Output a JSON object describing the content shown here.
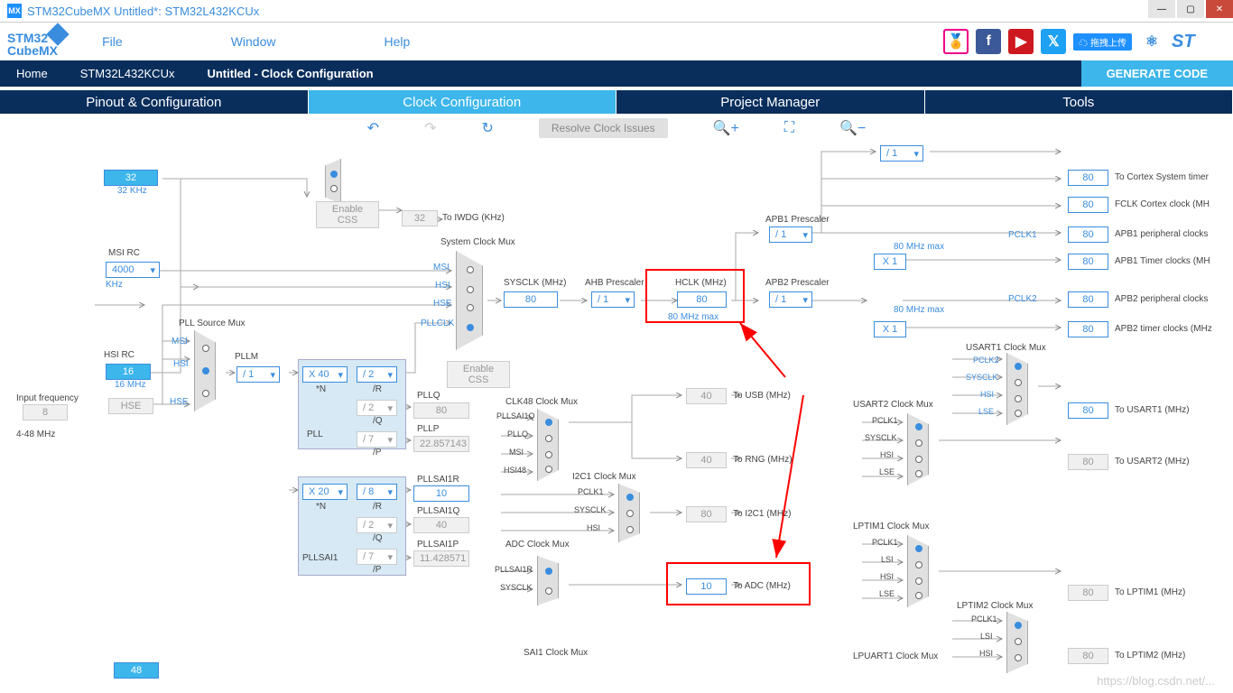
{
  "window": {
    "title": "STM32CubeMX Untitled*: STM32L432KCUx",
    "appicon": "MX"
  },
  "logo": {
    "l1": "STM32",
    "l2": "CubeMX"
  },
  "menu": {
    "file": "File",
    "window": "Window",
    "help": "Help",
    "upload": "拖拽上传"
  },
  "breadcrumb": {
    "home": "Home",
    "chip": "STM32L432KCUx",
    "page": "Untitled - Clock Configuration",
    "gen": "GENERATE CODE"
  },
  "tabs": {
    "pinout": "Pinout & Configuration",
    "clock": "Clock Configuration",
    "pm": "Project Manager",
    "tools": "Tools"
  },
  "toolbar": {
    "resolve": "Resolve Clock Issues"
  },
  "diagram": {
    "khz32": "32",
    "khz32lbl": "32 KHz",
    "enablecss": "Enable CSS",
    "toiwdg": "To IWDG (KHz)",
    "iwdg": "32",
    "sysclockmux": "System Clock Mux",
    "msi": "MSI",
    "hsi": "HSI",
    "hse": "HSE",
    "pllclk": "PLLCLK",
    "msirc": "MSI RC",
    "msival": "4000",
    "khz": "KHz",
    "pllsrcmux": "PLL Source Mux",
    "hsirc": "HSI RC",
    "hsival": "16",
    "mhz16": "16 MHz",
    "hsebox": "HSE",
    "inputfreq": "Input frequency",
    "inputval": "8",
    "inprange": "4-48 MHz",
    "pllm": "PLLM",
    "pllm_div": "/ 1",
    "pll_n": "X 40",
    "pll_nlbl": "*N",
    "pll_r": "/ 2",
    "pll_rlbl": "/R",
    "pll_q": "/ 2",
    "pll_qlbl": "/Q",
    "pll_p": "/ 7",
    "pll_plbl": "/P",
    "pll_label": "PLL",
    "pllq": "PLLQ",
    "pllqval": "80",
    "pllp": "PLLP",
    "pllpval": "22.857143",
    "pllsai_n": "X 20",
    "pllsai_r": "/ 8",
    "pllsai_rlbl": "/R",
    "pllsai_q": "/ 2",
    "pllsai_qlbl": "/Q",
    "pllsai_p": "/ 7",
    "pllsai_plbl": "/P",
    "pllsai1r": "PLLSAI1R",
    "pllsai1rval": "10",
    "pllsai1q": "PLLSAI1Q",
    "pllsai1qval": "40",
    "pllsai1p": "PLLSAI1P",
    "pllsai1pval": "11.428571",
    "pllsai1": "PLLSAI1",
    "enablecss2": "Enable CSS",
    "sysclk": "SYSCLK (MHz)",
    "sysclkval": "80",
    "ahbpre": "AHB Prescaler",
    "ahbdiv": "/ 1",
    "hclk": "HCLK (MHz)",
    "hclkval": "80",
    "hclkmax": "80 MHz max",
    "apb1pre": "APB1 Prescaler",
    "apb1div": "/ 1",
    "apb2pre": "APB2 Prescaler",
    "apb2div": "/ 1",
    "div1_top": "/ 1",
    "x1apb1": "X 1",
    "x1apb2": "X 1",
    "pclk1": "PCLK1",
    "pclk1max": "80 MHz max",
    "pclk2": "PCLK2",
    "pclk2max": "80 MHz max",
    "out_cortex": "80",
    "out_cortexlbl": "To Cortex System timer",
    "out_fclk": "80",
    "out_fclklbl": "FCLK Cortex clock (MH",
    "out_apb1p": "80",
    "out_apb1plbl": "APB1 peripheral clocks",
    "out_apb1t": "80",
    "out_apb1tlbl": "APB1 Timer clocks (MH",
    "out_apb2p": "80",
    "out_apb2plbl": "APB2 peripheral clocks",
    "out_apb2t": "80",
    "out_apb2tlbl": "APB2 timer clocks (MHz",
    "clk48mux": "CLK48 Clock Mux",
    "pllsai1q_in": "PLLSAI1Q",
    "pllq_in": "PLLQ",
    "msi_in": "MSI",
    "hsi48_in": "HSI48",
    "i2c1mux": "I2C1 Clock Mux",
    "pclk1_in": "PCLK1",
    "sysclk_in": "SYSCLK",
    "hsi_in": "HSI",
    "adcmux": "ADC Clock Mux",
    "pllsai1r_in": "PLLSAI1R",
    "sai1mux": "SAI1 Clock Mux",
    "tousb": "40",
    "tousblbl": "To USB (MHz)",
    "torng": "40",
    "tornglbl": "To RNG (MHz)",
    "toi2c": "80",
    "toi2clbl": "To I2C1 (MHz)",
    "toadc": "10",
    "toadclbl": "To ADC (MHz)",
    "usart1mux": "USART1 Clock Mux",
    "usart2mux": "USART2 Clock Mux",
    "lptim1mux": "LPTIM1 Clock Mux",
    "lptim2mux": "LPTIM2 Clock Mux",
    "lpuart1mux": "LPUART1 Clock Mux",
    "lse": "LSE",
    "lsi": "LSI",
    "tousart1": "80",
    "tousart1lbl": "To USART1 (MHz)",
    "tousart2": "80",
    "tousart2lbl": "To USART2 (MHz)",
    "tolptim1": "80",
    "tolptim1lbl": "To LPTIM1 (MHz)",
    "tolptim2": "80",
    "tolptim2lbl": "To LPTIM2 (MHz)",
    "val48": "48"
  }
}
